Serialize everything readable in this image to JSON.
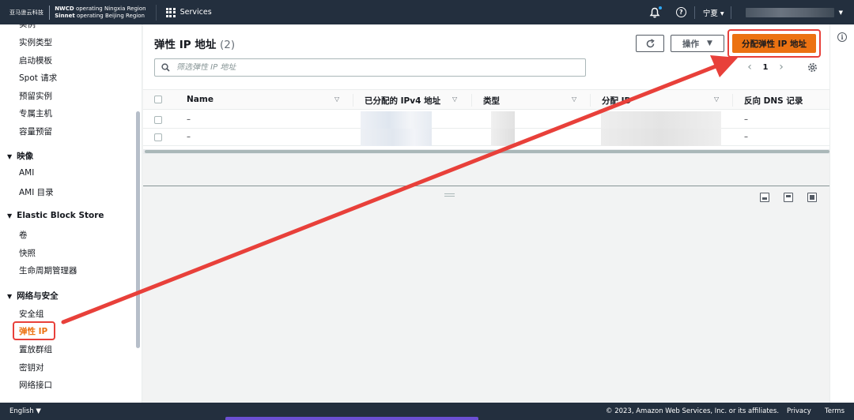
{
  "topbar": {
    "logo_text": "亚马逊云科技",
    "operator_line1_bold": "NWCD",
    "operator_line1": " operating Ningxia Region",
    "operator_line2_bold": "Sinnet",
    "operator_line2": " operating Beijing Region",
    "services_label": "Services",
    "region_label": "宁夏 ▾",
    "icons": [
      "grid-icon",
      "bell-icon",
      "help-icon",
      "chevron-down-icon"
    ]
  },
  "sidebar": {
    "items": [
      {
        "label": "实例"
      },
      {
        "label": "实例类型"
      },
      {
        "label": "启动模板"
      },
      {
        "label": "Spot 请求"
      },
      {
        "label": "预留实例"
      },
      {
        "label": "专属主机"
      },
      {
        "label": "容量预留"
      }
    ],
    "sections": [
      {
        "title": "映像",
        "items": [
          "AMI",
          "AMI 目录"
        ]
      },
      {
        "title": "Elastic Block Store",
        "items": [
          "卷",
          "快照",
          "生命周期管理器"
        ]
      },
      {
        "title": "网络与安全",
        "items": [
          "安全组",
          "弹性 IP",
          "置放群组",
          "密钥对",
          "网络接口"
        ]
      }
    ],
    "active_item": "弹性 IP"
  },
  "main": {
    "title": "弹性 IP 地址",
    "count": "(2)",
    "actions_label": "操作",
    "allocate_label": "分配弹性 IP 地址",
    "search_placeholder": "筛选弹性 IP 地址",
    "page_number": "1",
    "columns": [
      "Name",
      "已分配的 IPv4 地址",
      "类型",
      "分配 ID",
      "反向 DNS 记录"
    ],
    "rows": [
      {
        "name": "–",
        "reverse_dns": "–"
      },
      {
        "name": "–",
        "reverse_dns": "–"
      }
    ]
  },
  "footer": {
    "language": "English ▼",
    "copyright": "© 2023, Amazon Web Services, Inc. or its affiliates.",
    "privacy": "Privacy",
    "terms": "Terms"
  },
  "colors": {
    "primary": "#ec7211",
    "highlight": "#e8403a",
    "header_bg": "#232f3e"
  }
}
